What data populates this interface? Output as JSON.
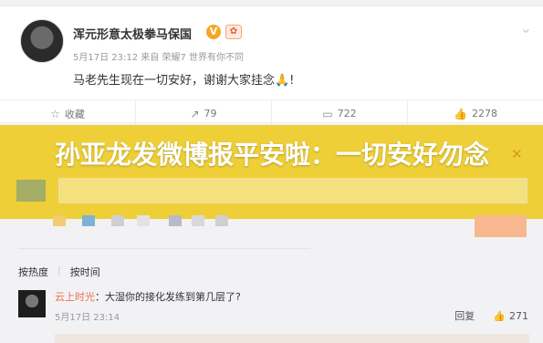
{
  "post": {
    "username": "浑元形意太极拳马保国",
    "vip_badge": "V",
    "meta": "5月17日 23:12 来自 荣耀7 世界有你不同",
    "content": "马老先生现在一切安好，谢谢大家挂念🙏!",
    "actions": [
      {
        "icon": "star-icon",
        "label": "收藏"
      },
      {
        "icon": "share-icon",
        "label": "79"
      },
      {
        "icon": "comment-icon",
        "label": "722"
      },
      {
        "icon": "like-icon",
        "label": "2278"
      }
    ]
  },
  "overlay": {
    "headline": "孙亚龙发微博报平安啦：一切安好勿念"
  },
  "comments": {
    "sort_hot": "按热度",
    "sort_time": "按时间",
    "items": [
      {
        "user": "云上时光",
        "text": "：大湿你的接化发练到第几层了?",
        "time": "5月17日 23:14",
        "reply_label": "回复",
        "likes": "271"
      }
    ]
  },
  "colors": {
    "band": "#eecc28",
    "username_link": "#eb7350"
  }
}
